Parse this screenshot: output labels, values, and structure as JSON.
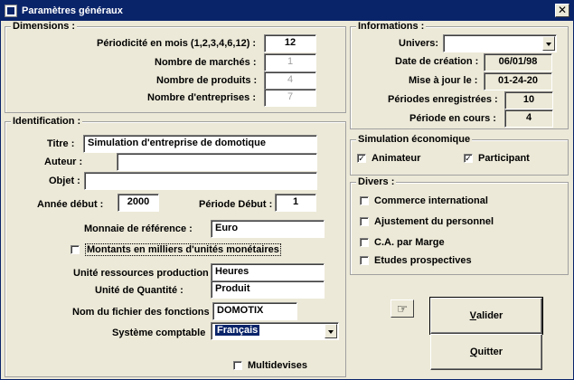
{
  "window": {
    "title": "Paramètres généraux",
    "close_glyph": "✕"
  },
  "dimensions": {
    "title": "Dimensions :",
    "periodicite_label": "Périodicité en mois  (1,2,3,4,6,12) :",
    "periodicite_value": "12",
    "marches_label": "Nombre de marchés :",
    "marches_value": "1",
    "produits_label": "Nombre de produits :",
    "produits_value": "4",
    "entreprises_label": "Nombre d'entreprises :",
    "entreprises_value": "7"
  },
  "identification": {
    "title": "Identification :",
    "titre_label": "Titre :",
    "titre_value": "Simulation d'entreprise de domotique",
    "auteur_label": "Auteur :",
    "auteur_value": "",
    "objet_label": "Objet :",
    "objet_value": "",
    "annee_label": "Année début :",
    "annee_value": "2000",
    "periode_label": "Période Début :",
    "periode_value": "1",
    "monnaie_label": "Monnaie de référence :",
    "monnaie_value": "Euro",
    "milliers_label": "Montants en milliers d'unités monétaires",
    "milliers_checked": "",
    "unite_res_label": "Unité ressources production :",
    "unite_res_value": "Heures",
    "unite_qte_label": "Unité de Quantité :",
    "unite_qte_value": "Produit",
    "fichier_label": "Nom du fichier des fonctions :",
    "fichier_value": "DOMOTIX",
    "systeme_label": "Système comptable",
    "systeme_value": "Français",
    "multidevises_label": "Multidevises",
    "multidevises_checked": ""
  },
  "informations": {
    "title": "Informations :",
    "univers_label": "Univers:",
    "univers_value": "",
    "creation_label": "Date de création :",
    "creation_value": "06/01/98",
    "maj_label": "Mise à jour le :",
    "maj_value": "01-24-20",
    "periodes_enr_label": "Périodes enregistrées :",
    "periodes_enr_value": "10",
    "periode_cours_label": "Période en cours :",
    "periode_cours_value": "4"
  },
  "simulation": {
    "title": "Simulation économique",
    "animateur_label": "Animateur",
    "animateur_checked": "✓",
    "participant_label": "Participant",
    "participant_checked": "✓"
  },
  "divers": {
    "title": "Divers :",
    "items": [
      {
        "label": "Commerce international",
        "checked": ""
      },
      {
        "label": "Ajustement du personnel",
        "checked": ""
      },
      {
        "label": "C.A. par Marge",
        "checked": ""
      },
      {
        "label": "Etudes prospectives",
        "checked": ""
      }
    ]
  },
  "buttons": {
    "hand_glyph": "☞",
    "valider_mnemonic": "V",
    "valider_rest": "alider",
    "quitter_mnemonic": "Q",
    "quitter_rest": "uitter"
  }
}
